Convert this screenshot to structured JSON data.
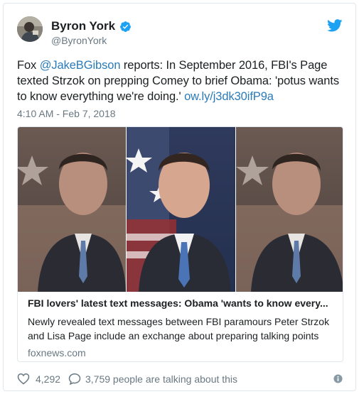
{
  "author": {
    "display_name": "Byron York",
    "handle": "@ByronYork",
    "verified": true,
    "verified_icon": "verified-badge-icon",
    "avatar_icon": "avatar-photo"
  },
  "tweet": {
    "text_pre": "Fox ",
    "mention": "@JakeBGibson",
    "text_mid": " reports: In September 2016, FBI's Page texted Strzok on prepping Comey to brief Obama: 'potus wants to know everything we're doing.' ",
    "link": "ow.ly/j3dk30ifP9a",
    "timestamp": "4:10 AM - Feb 7, 2018"
  },
  "card": {
    "image_icon": "news-photo-triptych",
    "title": "FBI lovers' latest text messages: Obama 'wants to know every...",
    "description": "Newly revealed text messages between FBI paramours Peter Strzok and Lisa Page include an exchange about preparing talking points",
    "domain": "foxnews.com"
  },
  "footer": {
    "likes": "4,292",
    "talking": "3,759 people are talking about this",
    "like_icon": "heart-icon",
    "comment_icon": "comment-icon",
    "info_icon": "info-icon"
  },
  "colors": {
    "link": "#2b7bb9",
    "secondary_text": "#697882",
    "twitter_blue": "#1da1f2",
    "border": "#e1e8ed"
  }
}
